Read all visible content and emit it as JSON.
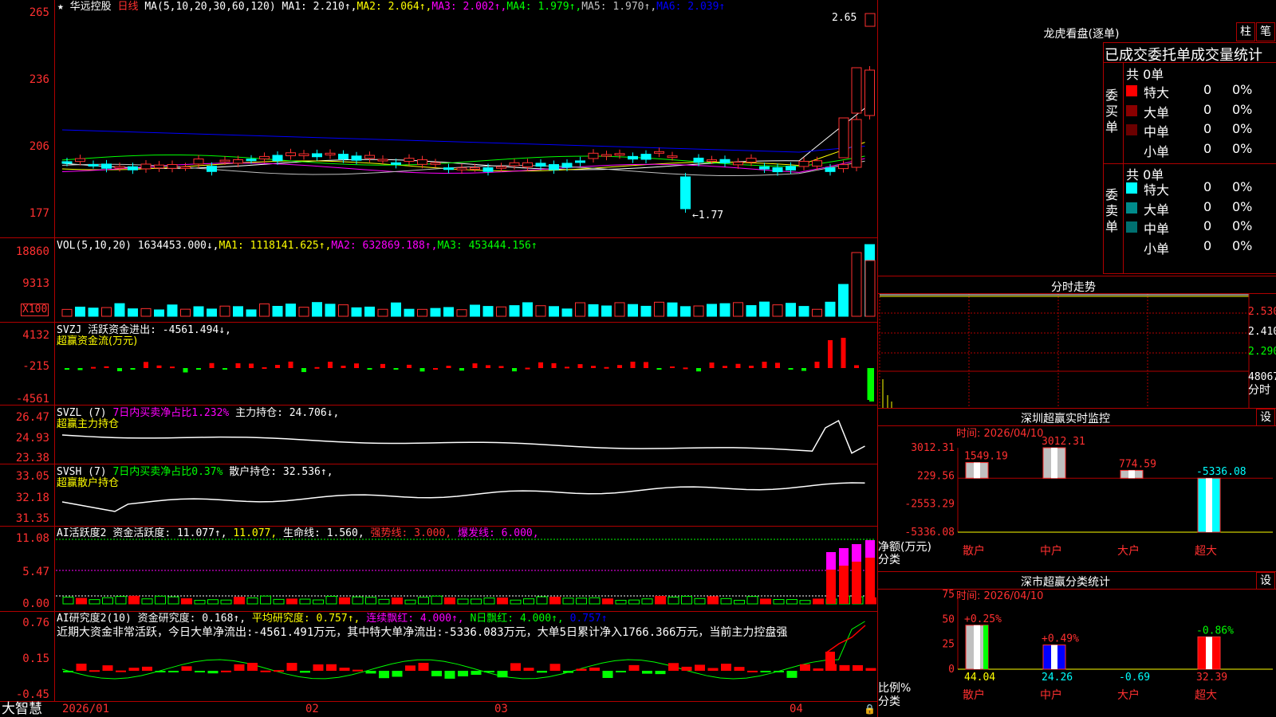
{
  "header": {
    "star": "★",
    "stock_name": "华远控股",
    "period": "日线",
    "ma_label": "MA(5,10,20,30,60,120)",
    "ma": [
      {
        "label": "MA1: 2.210↑,",
        "color": "#ffffff"
      },
      {
        "label": "MA2: 2.064↑,",
        "color": "#ffff00"
      },
      {
        "label": "MA3: 2.002↑,",
        "color": "#ff00ff"
      },
      {
        "label": "MA4: 1.979↑,",
        "color": "#00ff00"
      },
      {
        "label": "MA5: 1.970↑,",
        "color": "#c0c0c0"
      },
      {
        "label": "MA6: 2.039↑",
        "color": "#0000ff"
      }
    ]
  },
  "price_panel": {
    "y_ticks": [
      "265",
      "236",
      "206",
      "177"
    ],
    "high_label": "2.65",
    "low_label": "←1.77"
  },
  "vol_panel": {
    "title": "VOL(5,10,20)",
    "values": [
      {
        "label": "1634453.000↓,",
        "color": "#ffffff"
      },
      {
        "label": "MA1: 1118141.625↑,",
        "color": "#ffff00"
      },
      {
        "label": "MA2: 632869.188↑,",
        "color": "#ff00ff"
      },
      {
        "label": "MA3: 453444.156↑",
        "color": "#00ff00"
      }
    ],
    "y_ticks": [
      "18860",
      "9313"
    ],
    "unit": "X100"
  },
  "svzj_panel": {
    "title": "SVZJ  活跃资金进出: -4561.494↓,",
    "subtitle": "超赢资金流(万元)",
    "y_ticks": [
      "4132",
      "-215",
      "-4561"
    ]
  },
  "svzl_panel": {
    "title_a": "SVZL (7)",
    "title_b": "7日内买卖净占比1.232%",
    "title_c": "主力持仓: 24.706↓,",
    "subtitle": "超赢主力持仓",
    "y_ticks": [
      "26.47",
      "24.93",
      "23.38"
    ]
  },
  "svsh_panel": {
    "title_a": "SVSH (7)",
    "title_b": "7日内买卖净占比0.37%",
    "title_c": "散户持仓: 32.536↑,",
    "subtitle": "超赢散户持仓",
    "y_ticks": [
      "33.05",
      "32.18",
      "31.35"
    ]
  },
  "ai_active_panel": {
    "title_a": "AI活跃度2",
    "title_b": "资金活跃度: 11.077↑,",
    "title_c": "11.077,",
    "title_d": "生命线: 1.560,",
    "title_e": "强势线: 3.000,",
    "title_f": "爆发线: 6.000,",
    "y_ticks": [
      "11.08",
      "5.47",
      "0.00"
    ]
  },
  "ai_research_panel": {
    "title_a": "AI研究度2(10)",
    "title_b": "资金研究度: 0.168↑,",
    "title_c": "平均研究度: 0.757↑,",
    "title_d": "连续飘红: 4.000↑,",
    "title_e": "N日飘红: 4.000↑,",
    "title_f": "0.757↑",
    "note": "近期大资金非常活跃，今日大单净流出:-4561.491万元，其中特大单净流出:-5336.083万元，大单5日累计净入1766.366万元，当前主力控盘强",
    "y_ticks": [
      "0.76",
      "0.15",
      "-0.45"
    ]
  },
  "x_axis": {
    "brand": "大智慧",
    "labels": [
      "2026/01",
      "02",
      "03",
      "04"
    ]
  },
  "dragon_tiger": {
    "title": "龙虎看盘(逐单)",
    "btn_col": "柱",
    "btn_pen": "笔",
    "header": "已成交委托单成交量统计",
    "buy": {
      "side": "委买单",
      "total": "共 0单",
      "rows": [
        {
          "label": "特大",
          "count": "0",
          "pct": "0%",
          "color": "#ff0000"
        },
        {
          "label": "大单",
          "count": "0",
          "pct": "0%",
          "color": "#8b0000"
        },
        {
          "label": "中单",
          "count": "0",
          "pct": "0%",
          "color": "#6b0000"
        },
        {
          "label": "小单",
          "count": "0",
          "pct": "0%",
          "color": "#000000"
        }
      ]
    },
    "sell": {
      "side": "委卖单",
      "total": "共 0单",
      "rows": [
        {
          "label": "特大",
          "count": "0",
          "pct": "0%",
          "color": "#00ffff"
        },
        {
          "label": "大单",
          "count": "0",
          "pct": "0%",
          "color": "#008b8b"
        },
        {
          "label": "中单",
          "count": "0",
          "pct": "0%",
          "color": "#007070"
        },
        {
          "label": "小单",
          "count": "0",
          "pct": "0%",
          "color": "#000000"
        }
      ]
    }
  },
  "intraday": {
    "title": "分时走势",
    "y_ticks": [
      "2.530",
      "2.410",
      "2.290"
    ],
    "vol_tick": "48067",
    "unit": "分时"
  },
  "sz_monitor": {
    "title": "深圳超赢实时监控",
    "btn": "设",
    "time": "时间: 2026/04/10",
    "y_ticks": [
      "3012.31",
      "229.56",
      "-2553.29",
      "-5336.08"
    ],
    "unit": "净额(万元)",
    "unit2": "分类",
    "chart_data": {
      "type": "bar",
      "categories": [
        "散户",
        "中户",
        "大户",
        "超大"
      ],
      "values": [
        1549.19,
        3012.31,
        774.59,
        -5336.08
      ],
      "labels": [
        "1549.19",
        "3012.31",
        "774.59",
        "-5336.08"
      ],
      "ylabel": "净额(万元)",
      "ylim": [
        -5336.08,
        3012.31
      ]
    }
  },
  "sz_stats": {
    "title": "深市超赢分类统计",
    "btn": "设",
    "time": "时间: 2026/04/10",
    "y_ticks": [
      "75",
      "50",
      "25",
      "0"
    ],
    "unit": "比例%",
    "unit2": "分类",
    "chart_data": {
      "type": "bar",
      "categories": [
        "散户",
        "中户",
        "大户",
        "超大"
      ],
      "values": [
        44.04,
        24.26,
        -0.69,
        32.39
      ],
      "values_labels": [
        "44.04",
        "24.26",
        "-0.69",
        "32.39"
      ],
      "change_labels": [
        "+0.25%",
        "+0.49%",
        "",
        "-0.86%"
      ],
      "ylabel": "比例%",
      "ylim": [
        0,
        75
      ]
    }
  }
}
